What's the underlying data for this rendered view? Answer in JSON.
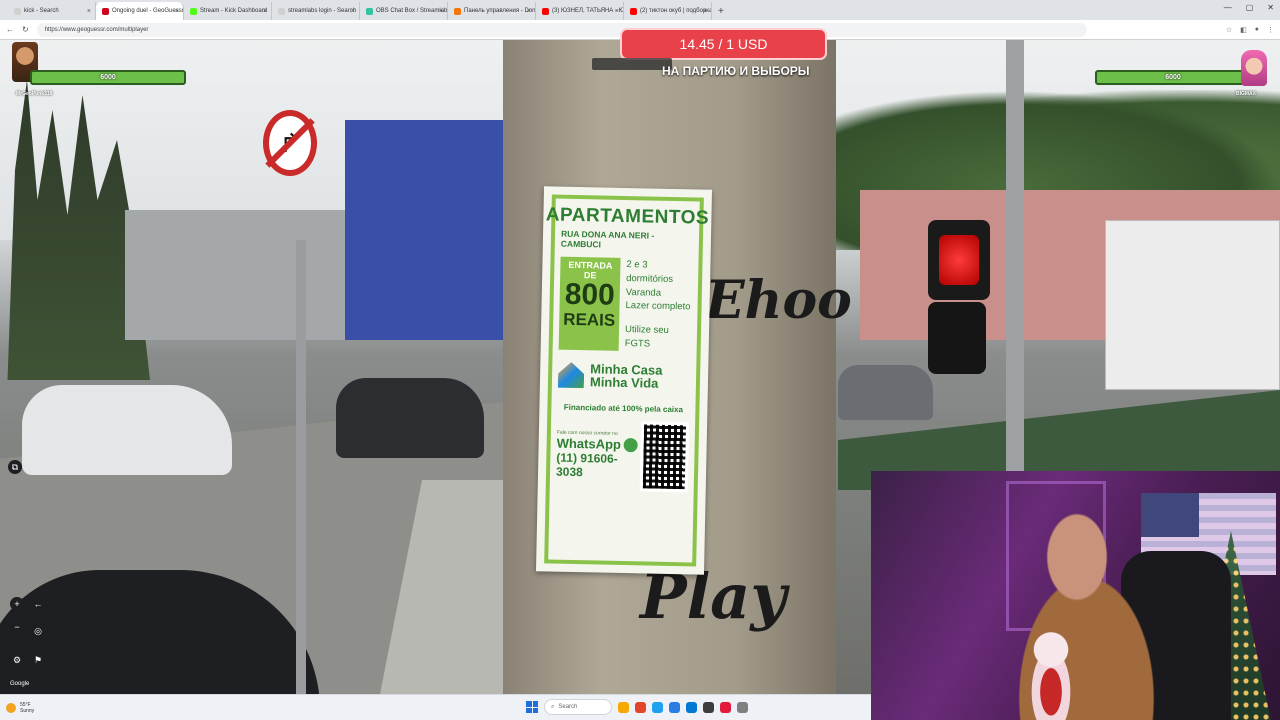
{
  "browser": {
    "tabs": [
      {
        "label": "kick - Search",
        "color": "#d0d0d0",
        "active": false
      },
      {
        "label": "Ongoing duel - GeoGuessr",
        "color": "#d0021b",
        "active": true
      },
      {
        "label": "Stream - Kick Dashboard",
        "color": "#53fc18",
        "active": false
      },
      {
        "label": "streamlabs login - Search",
        "color": "#d0d0d0",
        "active": false
      },
      {
        "label": "OBS Chat Box / Streamlabs",
        "color": "#31c3a2",
        "active": false
      },
      {
        "label": "Панель управления - DonationAlerts",
        "color": "#f57507",
        "active": false
      },
      {
        "label": "(3) ЮЗНЕЛ, ТАТЬЯНА - ЮНОСТЬ В...",
        "color": "#ff0000",
        "active": false
      },
      {
        "label": "(2) тиктон окуб | подборка моих...",
        "color": "#ff0000",
        "active": false
      }
    ],
    "new_tab": "+",
    "url": "https://www.geoguessr.com/multiplayer",
    "window_controls": [
      "—",
      "▢",
      "✕"
    ]
  },
  "game": {
    "price_banner": "14.45 / 1 USD",
    "ticker_text": "НА ПАРТИЮ И ВЫБОРЫ",
    "player_left": {
      "hp": "6000",
      "name": "MrGeoPunk318"
    },
    "player_right": {
      "hp": "6000",
      "name": "BIGMAX"
    },
    "google_label": "Google",
    "controls": {
      "zoom_in": "+",
      "zoom_out": "−",
      "back": "←",
      "settings": "⚙",
      "flag": "⚑",
      "compass": "◎",
      "layers": "⧉"
    }
  },
  "poster": {
    "title": "APARTAMENTOS",
    "street": "RUA DONA ANA NERI - CAMBUCI",
    "entrada": "ENTRADA DE",
    "price": "800",
    "currency": "REAIS",
    "features": [
      "2 e 3 dormitórios",
      "Varanda",
      "Lazer completo"
    ],
    "fgts": "Utilize seu FGTS",
    "brand_line1": "Minha Casa",
    "brand_line2": "Minha Vida",
    "financing": "Financiado até 100% pela caixa",
    "contact_small": "Fale com nosso corretor no",
    "whatsapp": "WhatsApp",
    "phone": "(11) 91606-3038"
  },
  "graffiti": {
    "left": "Ehoo",
    "bottom": "Play"
  },
  "taskbar": {
    "weather_temp": "55°F",
    "weather_desc": "Sunny",
    "search_placeholder": "Search",
    "app_colors": [
      "#f6a800",
      "#e2452a",
      "#1ea0f1",
      "#2c7be5",
      "#0078d4",
      "#3c3c3c",
      "#e21b3c",
      "#7f7f7f"
    ]
  }
}
